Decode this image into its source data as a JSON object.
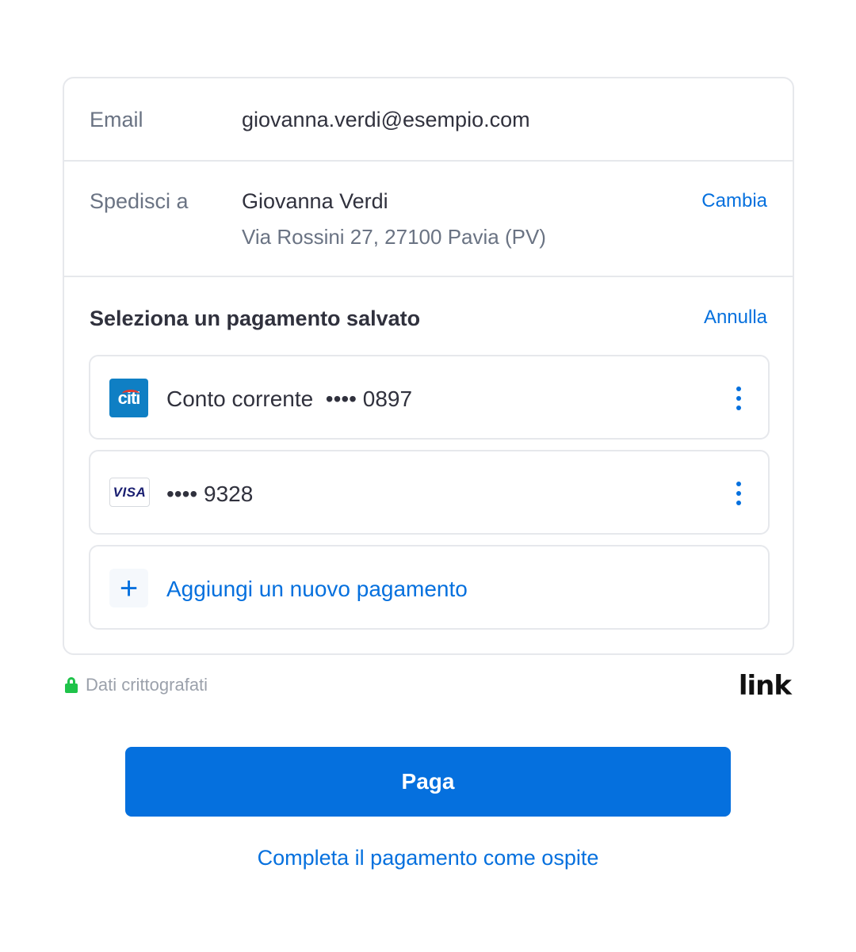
{
  "email": {
    "label": "Email",
    "value": "giovanna.verdi@esempio.com"
  },
  "shipping": {
    "label": "Spedisci a",
    "name": "Giovanna Verdi",
    "address": "Via Rossini 27, 27100 Pavia (PV)",
    "change_label": "Cambia"
  },
  "payment": {
    "title": "Seleziona un pagamento salvato",
    "cancel_label": "Annulla",
    "methods": [
      {
        "icon": "citi-bank-icon",
        "icon_text": "citi",
        "label": "Conto corrente  •••• 0897"
      },
      {
        "icon": "visa-card-icon",
        "icon_text": "VISA",
        "label": "•••• 9328"
      }
    ],
    "add_icon_text": "+",
    "add_label": "Aggiungi un nuovo pagamento"
  },
  "footer": {
    "secure_text": "Dati crittografati",
    "brand": "link"
  },
  "pay_button": "Paga",
  "guest_link": "Completa il pagamento come ospite",
  "colors": {
    "accent": "#0570de",
    "lock": "#1fc34a",
    "border": "#e6e8ec",
    "text": "#30313d",
    "muted": "#6a7383"
  }
}
